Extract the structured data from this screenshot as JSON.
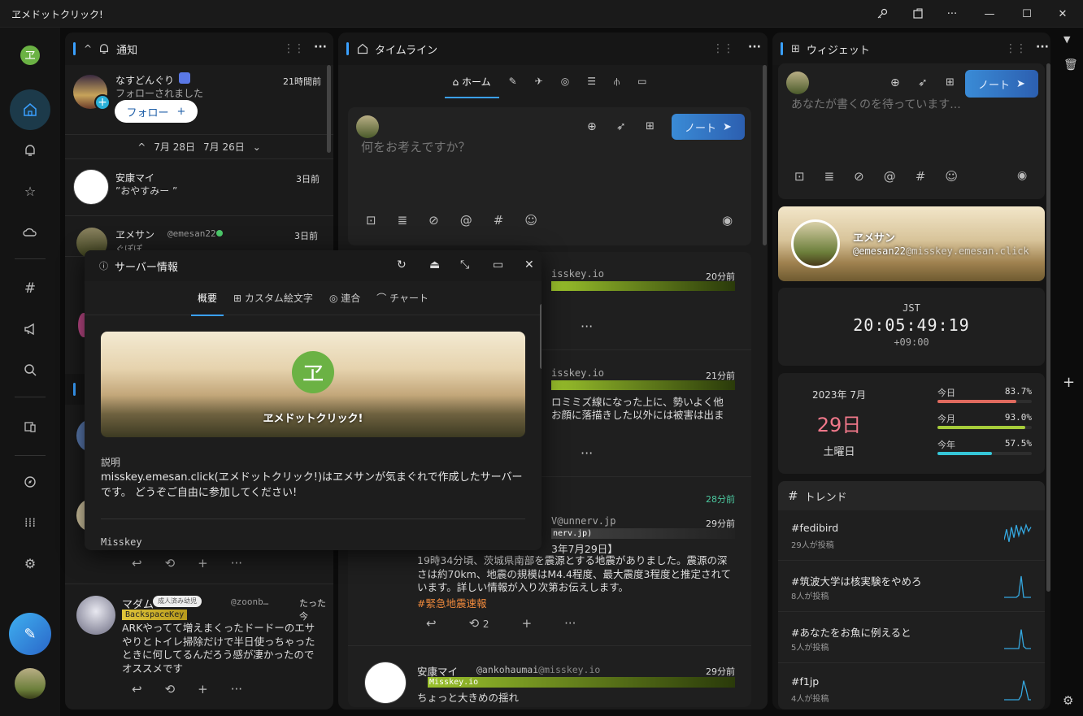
{
  "window": {
    "title": "ヱメドットクリック!"
  },
  "titlebar_icons": [
    "key-icon",
    "window-share-icon",
    "ellipsis-icon",
    "minimize-icon",
    "maximize-icon",
    "close-icon"
  ],
  "nav": {
    "items": [
      "home-icon",
      "bell-icon",
      "star-icon",
      "cloud-icon",
      "hash-icon",
      "megaphone-icon",
      "search-icon",
      "devices-icon",
      "compass-icon",
      "apps-icon",
      "gear-icon"
    ]
  },
  "notifications": {
    "title": "通知",
    "item1": {
      "name": "なすどんぐり",
      "sub": "フォローされました",
      "time": "21時間前",
      "follow_label": "フォロー"
    },
    "date_nav": {
      "left": "7月 28日",
      "right": "7月 26日"
    },
    "item2": {
      "name": "安康マイ",
      "text": "”おやすみー ”",
      "time": "3日前"
    },
    "item3": {
      "name": "ヱメサン",
      "handle": "@emesan22",
      "text": "ぐぽぽ",
      "time": "3日前"
    },
    "item4": {
      "name": "マダム",
      "badge": "成人済み幼児",
      "handle": "@zoonb…",
      "time": "たった今",
      "tag": "BackspaceKey",
      "text": "ARKやってて増えまくったドードーのエサやりとトイレ掃除だけで半日使っちゃったときに何してるんだろう感が凄かったのでオススメです"
    }
  },
  "timeline": {
    "title": "タイムライン",
    "tabs": [
      "ホーム"
    ],
    "composer": {
      "placeholder": "何をお考えですか？",
      "post_label": "ノート"
    },
    "notes": [
      {
        "host": "isskey.io",
        "time": "20分前"
      },
      {
        "host": "isskey.io",
        "time": "21分前",
        "text1": "ロミミズ線になった上に、勢いよく他",
        "text2": "お顔に落描きした以外には被害は出ま"
      },
      {
        "time_green": "28分前"
      },
      {
        "host": "V@unnerv.jp",
        "time": "29分前",
        "tag": "nerv.jp)",
        "line": "3年7月29日】",
        "body": "19時34分頃、茨城県南部を震源とする地震がありました。震源の深さは約70km、地震の規模はM4.4程度、最大震度3程度と推定されています。詳しい情報が入り次第お伝えします。",
        "hashtag": "#緊急地震速報",
        "renote_count": "2"
      },
      {
        "name": "安康マイ",
        "handle": "@ankohaumai",
        "host": "@misskey.io",
        "time": "29分前",
        "instance": "Misskey.io",
        "text": "ちょっと大きめの揺れ"
      }
    ]
  },
  "widgets": {
    "title": "ウィジェット",
    "composer": {
      "placeholder": "あなたが書くのを待っています...",
      "post_label": "ノート"
    },
    "profile": {
      "name": "ヱメサン",
      "handle": "@emesan22",
      "host": "@misskey.emesan.click"
    },
    "clock": {
      "tz": "JST",
      "time": "20:05:49:19",
      "offset": "+09:00"
    },
    "calendar": {
      "ym": "2023年 7月",
      "day": "29日",
      "weekday": "土曜日",
      "bars": [
        {
          "label": "今日",
          "value": "83.7%",
          "frac": 0.837,
          "color": "#e06a5e"
        },
        {
          "label": "今月",
          "value": "93.0%",
          "frac": 0.93,
          "color": "#a6cc3a"
        },
        {
          "label": "今年",
          "value": "57.5%",
          "frac": 0.575,
          "color": "#35c6d8"
        }
      ]
    },
    "trends": {
      "title": "トレンド",
      "items": [
        {
          "tag": "#fedibird",
          "count": "29人が投稿"
        },
        {
          "tag": "#筑波大学は核実験をやめろ",
          "count": "8人が投稿"
        },
        {
          "tag": "#あなたをお魚に例えると",
          "count": "5人が投稿"
        },
        {
          "tag": "#f1jp",
          "count": "4人が投稿"
        }
      ]
    }
  },
  "modal": {
    "title": "サーバー情報",
    "tabs": [
      "概要",
      "カスタム絵文字",
      "連合",
      "チャート"
    ],
    "banner_name": "ヱメドットクリック!",
    "desc_label": "説明",
    "desc": "misskey.emesan.click(ヱメドットクリック!)はヱメサンが気まぐれで作成したサーバーです。 どうぞご自由に参加してください!",
    "software_label": "Misskey",
    "logo_char": "ヱ"
  }
}
